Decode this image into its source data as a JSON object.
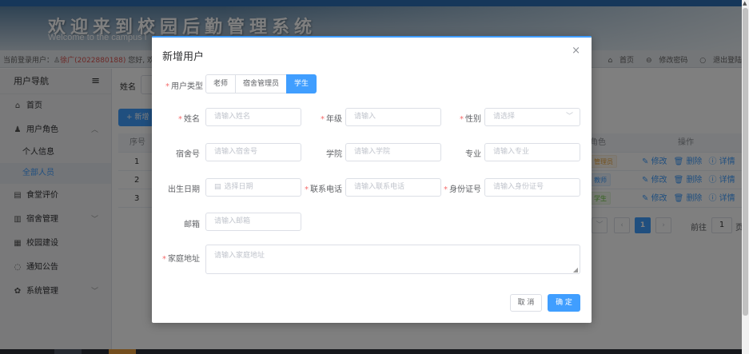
{
  "header": {
    "title": "欢迎来到校园后勤管理系统",
    "subtitle": "Welcome to the campus l"
  },
  "infobar": {
    "user_prefix": "当前登录用户：",
    "user_name": "徐广(2022880188)",
    "greeting": " 您好, 欢",
    "home": "首页",
    "change_pwd": "修改密码",
    "logout": "退出登陆"
  },
  "sidebar": {
    "title": "用户导航",
    "items": [
      {
        "label": "首页",
        "icon": "home-icon"
      },
      {
        "label": "用户角色",
        "icon": "user-icon"
      },
      {
        "label": "个人信息"
      },
      {
        "label": "全部人员"
      },
      {
        "label": "食堂评价",
        "icon": "document-icon"
      },
      {
        "label": "宿舍管理",
        "icon": "building-icon"
      },
      {
        "label": "校园建设",
        "icon": "chart-icon"
      },
      {
        "label": "通知公告",
        "icon": "bell-icon"
      },
      {
        "label": "系统管理",
        "icon": "gear-icon"
      }
    ]
  },
  "main": {
    "filter_label": "姓名",
    "add_button": "+ 新增",
    "table": {
      "headers": [
        "序号",
        "角色",
        "操作"
      ],
      "rows": [
        {
          "index": "1",
          "role": "管理员"
        },
        {
          "index": "2",
          "role": "教师"
        },
        {
          "index": "3",
          "role": "学生"
        }
      ],
      "ops": {
        "edit": "修改",
        "delete": "删除",
        "detail": "详情"
      }
    },
    "pager": {
      "current": "1",
      "goto_label": "前往",
      "goto_value": "1",
      "page_suffix": "页"
    }
  },
  "dialog": {
    "title": "新增用户",
    "close": "×",
    "user_type_label": "用户类型",
    "user_types": [
      "老师",
      "宿舍管理员",
      "学生"
    ],
    "selected_user_type": "学生",
    "fields": {
      "name": {
        "label": "姓名",
        "placeholder": "请输入姓名"
      },
      "grade": {
        "label": "年级",
        "placeholder": "请输入"
      },
      "gender": {
        "label": "性别",
        "placeholder": "请选择"
      },
      "dorm": {
        "label": "宿舍号",
        "placeholder": "请输入宿舍号"
      },
      "college": {
        "label": "学院",
        "placeholder": "请输入学院"
      },
      "major": {
        "label": "专业",
        "placeholder": "请输入专业"
      },
      "birthday": {
        "label": "出生日期",
        "placeholder": "选择日期"
      },
      "phone": {
        "label": "联系电话",
        "placeholder": "请输入联系电话"
      },
      "idcard": {
        "label": "身份证号",
        "placeholder": "请输入身份证号"
      },
      "email": {
        "label": "邮箱",
        "placeholder": "请输入邮箱"
      },
      "address": {
        "label": "家庭地址",
        "placeholder": "请输入家庭地址"
      }
    },
    "cancel": "取 消",
    "confirm": "确 定"
  }
}
